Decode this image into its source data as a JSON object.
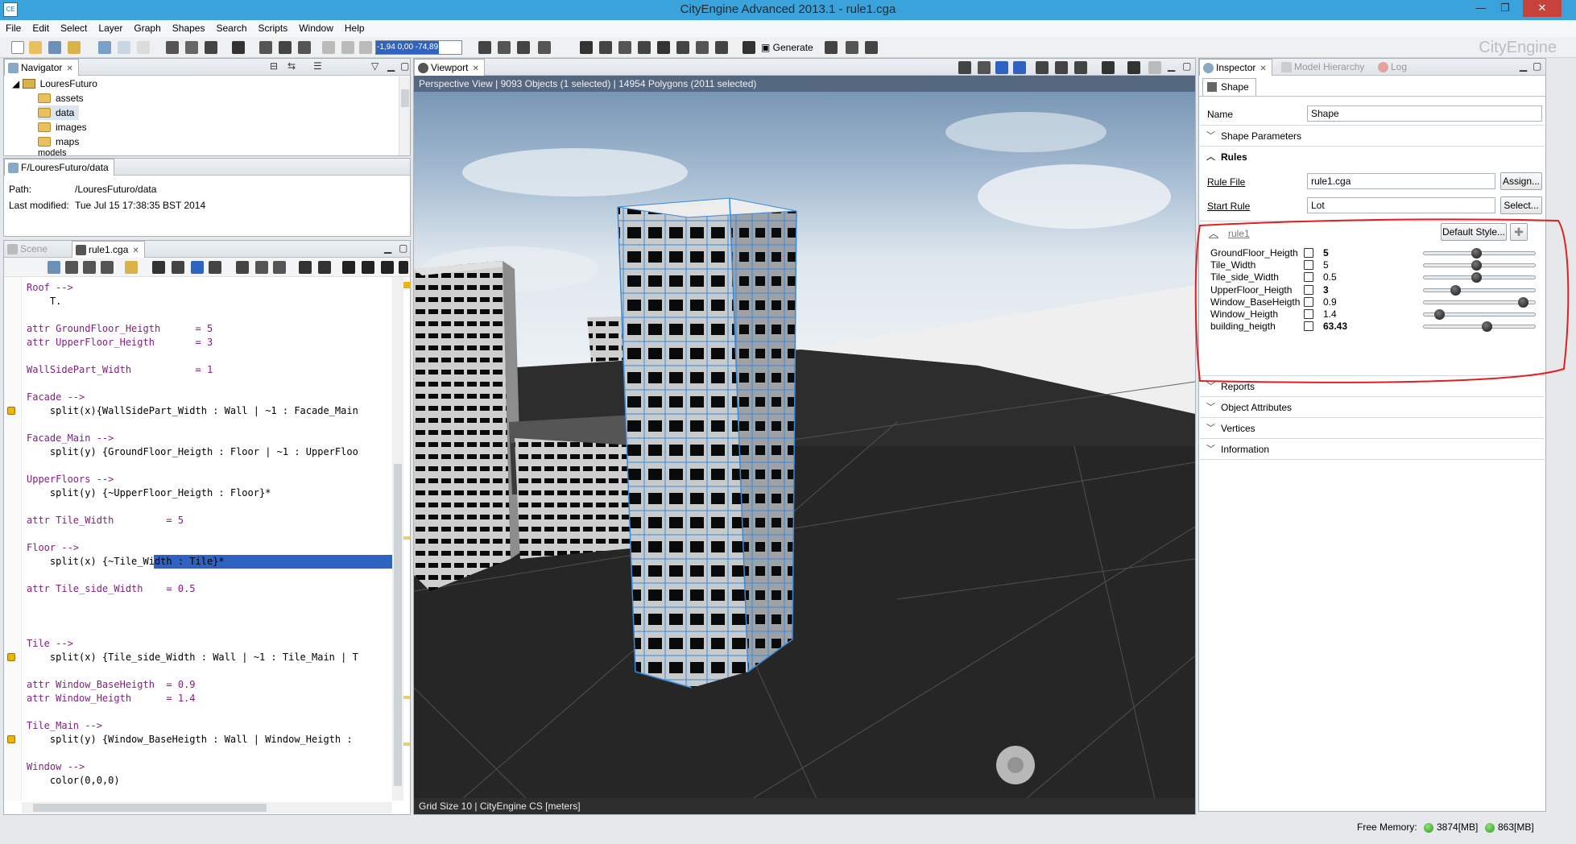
{
  "window": {
    "title": "CityEngine Advanced 2013.1 - rule1.cga",
    "app_icon": "CE"
  },
  "menu": [
    "File",
    "Edit",
    "Select",
    "Layer",
    "Graph",
    "Shapes",
    "Search",
    "Scripts",
    "Window",
    "Help"
  ],
  "toolbar": {
    "coord_value": "-1,94 0,00 -74,89",
    "generate_label": "Generate",
    "brand": "CityEngine"
  },
  "navigator": {
    "tab_label": "Navigator",
    "items": [
      {
        "label": "LouresFuturo",
        "type": "project"
      },
      {
        "label": "assets",
        "type": "folder"
      },
      {
        "label": "data",
        "type": "folder",
        "selected": true
      },
      {
        "label": "images",
        "type": "folder"
      },
      {
        "label": "maps",
        "type": "folder"
      },
      {
        "label": "models",
        "type": "folder"
      }
    ]
  },
  "path_panel": {
    "tab_label": "F/LouresFuturo/data",
    "path_label": "Path:",
    "path_value": "/LouresFuturo/data",
    "modified_label": "Last modified:",
    "modified_value": "Tue Jul 15 17:38:35 BST 2014"
  },
  "editor": {
    "tabs": [
      {
        "label": "Scene",
        "active": false
      },
      {
        "label": "rule1.cga",
        "active": true
      }
    ],
    "lines": [
      {
        "text": "Roof -->",
        "cls": "kw"
      },
      {
        "text": "    T.",
        "cls": ""
      },
      {
        "text": "",
        "cls": ""
      },
      {
        "text": "attr GroundFloor_Heigth      = 5",
        "cls": "attr"
      },
      {
        "text": "attr UpperFloor_Heigth       = 3",
        "cls": "attr"
      },
      {
        "text": "",
        "cls": ""
      },
      {
        "text": "WallSidePart_Width           = 1",
        "cls": "rn"
      },
      {
        "text": "",
        "cls": ""
      },
      {
        "text": "Facade -->",
        "cls": "kw"
      },
      {
        "text": "    split(x){WallSidePart_Width : Wall | ~1 : Facade_Main",
        "cls": ""
      },
      {
        "text": "",
        "cls": ""
      },
      {
        "text": "Facade_Main -->",
        "cls": "kw"
      },
      {
        "text": "    split(y) {GroundFloor_Heigth : Floor | ~1 : UpperFloo",
        "cls": ""
      },
      {
        "text": "",
        "cls": ""
      },
      {
        "text": "UpperFloors -->",
        "cls": "kw"
      },
      {
        "text": "    split(y) {~UpperFloor_Heigth : Floor}*",
        "cls": ""
      },
      {
        "text": "",
        "cls": ""
      },
      {
        "text": "attr Tile_Width         = 5",
        "cls": "attr"
      },
      {
        "text": "",
        "cls": ""
      },
      {
        "text": "Floor -->",
        "cls": "kw"
      },
      {
        "text": "    split(x) {~Tile_Width : Tile}*",
        "cls": "hlline"
      },
      {
        "text": "",
        "cls": ""
      },
      {
        "text": "attr Tile_side_Width    = 0.5",
        "cls": "attr"
      },
      {
        "text": "",
        "cls": ""
      },
      {
        "text": "",
        "cls": ""
      },
      {
        "text": "",
        "cls": ""
      },
      {
        "text": "Tile -->",
        "cls": "kw"
      },
      {
        "text": "    split(x) {Tile_side_Width : Wall | ~1 : Tile_Main | T",
        "cls": ""
      },
      {
        "text": "",
        "cls": ""
      },
      {
        "text": "attr Window_BaseHeigth  = 0.9",
        "cls": "attr"
      },
      {
        "text": "attr Window_Heigth      = 1.4",
        "cls": "attr"
      },
      {
        "text": "",
        "cls": ""
      },
      {
        "text": "Tile_Main -->",
        "cls": "kw"
      },
      {
        "text": "    split(y) {Window_BaseHeigth : Wall | Window_Heigth :",
        "cls": ""
      },
      {
        "text": "",
        "cls": ""
      },
      {
        "text": "Window -->",
        "cls": "kw"
      },
      {
        "text": "    color(0,0,0)",
        "cls": ""
      }
    ],
    "warning_lines": [
      9,
      27,
      33
    ]
  },
  "viewport": {
    "tab_label": "Viewport",
    "info": "Perspective View  |  9093 Objects  (1 selected)  |  14954 Polygons  (2011 selected)",
    "status": "Grid Size 10  |  CityEngine CS [meters]"
  },
  "inspector": {
    "tabs": [
      {
        "label": "Inspector",
        "active": true
      },
      {
        "label": "Model Hierarchy",
        "active": false
      },
      {
        "label": "Log",
        "active": false
      }
    ],
    "shape_tab": "Shape",
    "name_label": "Name",
    "name_value": "Shape",
    "shape_params_label": "Shape Parameters",
    "rules_label": "Rules",
    "rule_file_label": "Rule File",
    "rule_file_value": "rule1.cga",
    "assign_label": "Assign...",
    "start_rule_label": "Start Rule",
    "start_rule_value": "Lot",
    "select_label": "Select...",
    "rule1_label": "rule1",
    "default_style_label": "Default Style...",
    "attributes": [
      {
        "name": "GroundFloor_Heigth",
        "value": "5",
        "bold": true,
        "level": 0.45
      },
      {
        "name": "Tile_Width",
        "value": "5",
        "bold": false,
        "level": 0.45
      },
      {
        "name": "Tile_side_Width",
        "value": "0.5",
        "bold": false,
        "level": 0.45
      },
      {
        "name": "UpperFloor_Heigth",
        "value": "3",
        "bold": true,
        "level": 0.25
      },
      {
        "name": "Window_BaseHeigth",
        "value": "0.9",
        "bold": false,
        "level": 0.9
      },
      {
        "name": "Window_Heigth",
        "value": "1.4",
        "bold": false,
        "level": 0.1
      },
      {
        "name": "building_heigth",
        "value": "63.43",
        "bold": true,
        "level": 0.55
      }
    ],
    "sections": [
      "Reports",
      "Object Attributes",
      "Vertices",
      "Information"
    ]
  },
  "status": {
    "free_memory_label": "Free Memory:",
    "mem1": "3874[MB]",
    "mem2": "863[MB]"
  },
  "colors": {
    "accent": "#3ba3dc",
    "selection": "#2f63c2",
    "annotation": "#e02020"
  }
}
